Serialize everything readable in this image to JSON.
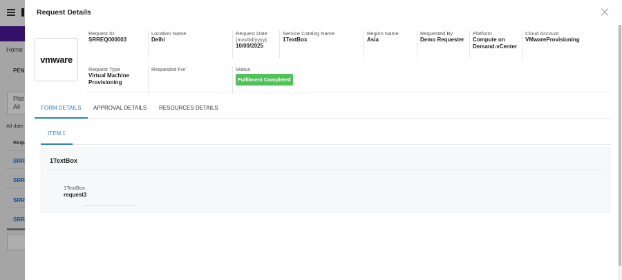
{
  "background": {
    "breadcrumb": "Home",
    "tab_partial": "PENI",
    "platform_label": "Plat",
    "platform_value": "All",
    "filter_text": "All date",
    "column_header": "Requ",
    "row_links": [
      "SRRE",
      "SRRE",
      "SRRE",
      "SRRE"
    ]
  },
  "panel": {
    "title": "Request Details",
    "close_icon": "close-icon",
    "logo": "vmware"
  },
  "fields": {
    "request_id": {
      "label": "Request ID",
      "value": "SRREQ000003"
    },
    "location_name": {
      "label": "Location Name",
      "value": "Delhi"
    },
    "request_date": {
      "label": "Request Date (mm/dd/yyyy)",
      "value": "10/09/2025"
    },
    "service_catalog_name": {
      "label": "Service Catalog Name",
      "value": "1TextBox"
    },
    "region_name": {
      "label": "Region Name",
      "value": "Asia"
    },
    "requested_by": {
      "label": "Requested By",
      "value": "Demo Requester"
    },
    "platform": {
      "label": "Platform",
      "value": "Compute on Demand-vCenter"
    },
    "cloud_account": {
      "label": "Cloud Account",
      "value": "VMwareProvisioning"
    },
    "request_type": {
      "label": "Request Type",
      "value": "Virtual Machine Provisioning"
    },
    "requested_for": {
      "label": "Requested For",
      "value": ""
    },
    "status": {
      "label": "Status",
      "value": "Fulfilment Completed"
    }
  },
  "tabs": [
    {
      "label": "FORM DETAILS",
      "active": true
    },
    {
      "label": "APPROVAL DETAILS",
      "active": false
    },
    {
      "label": "RESOURCES DETAILS",
      "active": false
    }
  ],
  "subtabs": [
    {
      "label": "ITEM 1",
      "active": true
    }
  ],
  "form": {
    "section_title": "1TextBox",
    "field_label": "1TextBox",
    "field_value": "request3"
  },
  "colors": {
    "accent": "#2b7fc1",
    "status_green": "#52c15a",
    "topbar_purple": "#4a1a9a"
  }
}
